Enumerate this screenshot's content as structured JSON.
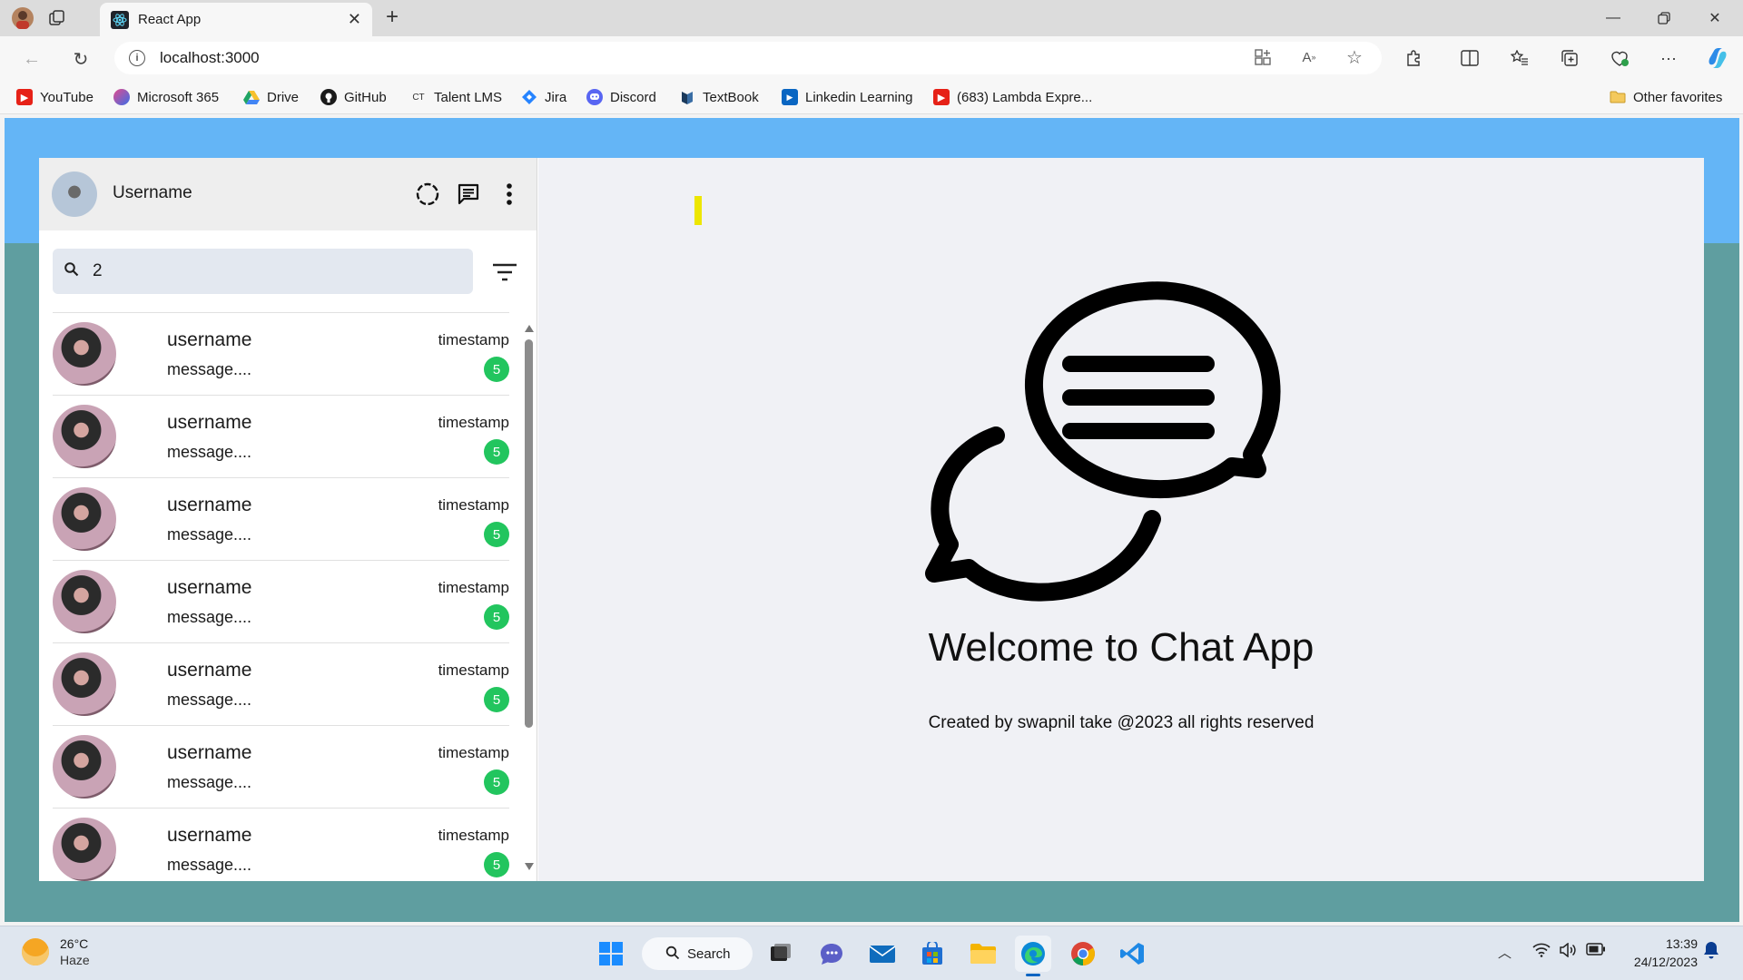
{
  "browser": {
    "tab_title": "React App",
    "url": "localhost:3000",
    "bookmarks": [
      {
        "label": "YouTube",
        "icon": "youtube-icon"
      },
      {
        "label": "Microsoft 365",
        "icon": "microsoft365-icon"
      },
      {
        "label": "Drive",
        "icon": "drive-icon"
      },
      {
        "label": "GitHub",
        "icon": "github-icon"
      },
      {
        "label": "Talent LMS",
        "icon": "talentlms-icon",
        "icon_text": "CT"
      },
      {
        "label": "Jira",
        "icon": "jira-icon"
      },
      {
        "label": "Discord",
        "icon": "discord-icon"
      },
      {
        "label": "TextBook",
        "icon": "textbook-icon"
      },
      {
        "label": "Linkedin Learning",
        "icon": "linkedin-learning-icon"
      },
      {
        "label": "(683) Lambda Expre...",
        "icon": "youtube-icon"
      }
    ],
    "other_favorites": "Other favorites"
  },
  "app": {
    "sidebar": {
      "username": "Username",
      "search_value": "2",
      "chats": [
        {
          "name": "username",
          "message": "message....",
          "timestamp": "timestamp",
          "unread": "5"
        },
        {
          "name": "username",
          "message": "message....",
          "timestamp": "timestamp",
          "unread": "5"
        },
        {
          "name": "username",
          "message": "message....",
          "timestamp": "timestamp",
          "unread": "5"
        },
        {
          "name": "username",
          "message": "message....",
          "timestamp": "timestamp",
          "unread": "5"
        },
        {
          "name": "username",
          "message": "message....",
          "timestamp": "timestamp",
          "unread": "5"
        },
        {
          "name": "username",
          "message": "message....",
          "timestamp": "timestamp",
          "unread": "5"
        },
        {
          "name": "username",
          "message": "message....",
          "timestamp": "timestamp",
          "unread": "5"
        }
      ]
    },
    "main": {
      "welcome_title": "Welcome to Chat App",
      "welcome_subtitle": "Created by swapnil take @2023 all rights reserved"
    },
    "colors": {
      "page_top": "#64b5f6",
      "page_bottom": "#5f9ea0",
      "badge": "#22c55e",
      "search_bg": "#e3e8f0",
      "main_bg": "#f0f1f5"
    }
  },
  "taskbar": {
    "temperature": "26°C",
    "condition": "Haze",
    "search_label": "Search",
    "time": "13:39",
    "date": "24/12/2023"
  }
}
